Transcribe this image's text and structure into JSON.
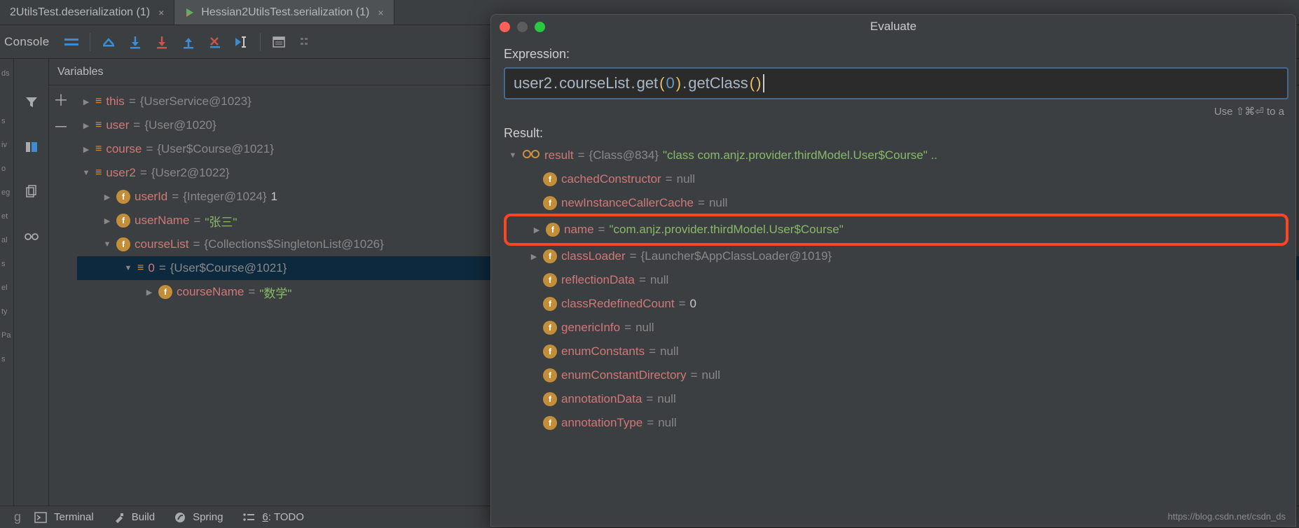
{
  "tabs": [
    {
      "label": "2UtilsTest.deserialization (1)",
      "active": false
    },
    {
      "label": "Hessian2UtilsTest.serialization (1)",
      "active": true
    }
  ],
  "toolbar": {
    "console_label": "Console"
  },
  "leftstrip": [
    "ds",
    "",
    "s",
    "iv",
    "o",
    "eg",
    "et",
    "al",
    "s",
    "el",
    "ty",
    "Pa",
    "s"
  ],
  "vars_header": "Variables",
  "tree": [
    {
      "indent": 0,
      "arrow": "right",
      "icon": "bars",
      "name": "this",
      "eq": " = ",
      "val": "{UserService@1023}",
      "valclass": "val-gray"
    },
    {
      "indent": 0,
      "arrow": "right",
      "icon": "bars",
      "name": "user",
      "eq": " = ",
      "val": "{User@1020}",
      "valclass": "val-gray"
    },
    {
      "indent": 0,
      "arrow": "right",
      "icon": "bars",
      "name": "course",
      "eq": " = ",
      "val": "{User$Course@1021}",
      "valclass": "val-gray"
    },
    {
      "indent": 0,
      "arrow": "down",
      "icon": "bars",
      "name": "user2",
      "eq": " = ",
      "val": "{User2@1022}",
      "valclass": "val-gray"
    },
    {
      "indent": 1,
      "arrow": "right",
      "icon": "field",
      "name": "userId",
      "eq": " = ",
      "val": "{Integer@1024} ",
      "valclass": "val-gray",
      "suffix": "1",
      "sfx": "val-num"
    },
    {
      "indent": 1,
      "arrow": "right",
      "icon": "field",
      "name": "userName",
      "eq": " = ",
      "val": "\"张三\"",
      "valclass": "val-greenstr"
    },
    {
      "indent": 1,
      "arrow": "down",
      "icon": "field",
      "name": "courseList",
      "eq": " = ",
      "val": "{Collections$SingletonList@1026}",
      "valclass": "val-gray"
    },
    {
      "indent": 2,
      "arrow": "down",
      "icon": "bars",
      "name": "0",
      "eq": " = ",
      "val": "{User$Course@1021}",
      "valclass": "val-gray",
      "selected": true
    },
    {
      "indent": 3,
      "arrow": "right",
      "icon": "field",
      "name": "courseName",
      "eq": " = ",
      "val": "\"数学\"",
      "valclass": "val-greenstr"
    }
  ],
  "bottom": {
    "terminal": "Terminal",
    "build": "Build",
    "spring": "Spring",
    "todo": "6: TODO"
  },
  "evaluate": {
    "title": "Evaluate",
    "expression_label": "Expression:",
    "expr_tokens": [
      {
        "t": "user2",
        "c": "id"
      },
      {
        "t": ".",
        "c": "dot-tok"
      },
      {
        "t": "courseList",
        "c": "id"
      },
      {
        "t": ".",
        "c": "dot-tok"
      },
      {
        "t": "get",
        "c": "method"
      },
      {
        "t": "(",
        "c": "paren"
      },
      {
        "t": "0",
        "c": "num"
      },
      {
        "t": ")",
        "c": "paren"
      },
      {
        "t": ".",
        "c": "dot-tok"
      },
      {
        "t": "getClass",
        "c": "method"
      },
      {
        "t": "(",
        "c": "paren"
      },
      {
        "t": ")",
        "c": "paren"
      }
    ],
    "hint": "Use ⇧⌘⏎ to a",
    "result_label": "Result:",
    "url": "https://blog.csdn.net/csdn_ds",
    "result_rows": [
      {
        "indent": 0,
        "arrow": "down",
        "icon": "glasses",
        "name": "result",
        "eq": " = ",
        "val": "{Class@834} ",
        "valclass": "val-gray",
        "suffix": "\"class com.anjz.provider.thirdModel.User$Course\" ..",
        "sfx": "val-greenstr"
      },
      {
        "indent": 1,
        "arrow": "",
        "icon": "field",
        "name": "cachedConstructor",
        "eq": " = ",
        "val": "null",
        "valclass": "val-gray"
      },
      {
        "indent": 1,
        "arrow": "",
        "icon": "field",
        "name": "newInstanceCallerCache",
        "eq": " = ",
        "val": "null",
        "valclass": "val-gray"
      },
      {
        "indent": 1,
        "arrow": "right",
        "icon": "field",
        "name": "name",
        "eq": " = ",
        "val": "\"com.anjz.provider.thirdModel.User$Course\"",
        "valclass": "val-greenstr",
        "highlight": true
      },
      {
        "indent": 1,
        "arrow": "right",
        "icon": "field",
        "name": "classLoader",
        "eq": " = ",
        "val": "{Launcher$AppClassLoader@1019}",
        "valclass": "val-gray"
      },
      {
        "indent": 1,
        "arrow": "",
        "icon": "field",
        "name": "reflectionData",
        "eq": " = ",
        "val": "null",
        "valclass": "val-gray"
      },
      {
        "indent": 1,
        "arrow": "",
        "icon": "field",
        "name": "classRedefinedCount",
        "eq": " = ",
        "val": "0",
        "valclass": "val-num"
      },
      {
        "indent": 1,
        "arrow": "",
        "icon": "field",
        "name": "genericInfo",
        "eq": " = ",
        "val": "null",
        "valclass": "val-gray"
      },
      {
        "indent": 1,
        "arrow": "",
        "icon": "field",
        "name": "enumConstants",
        "eq": " = ",
        "val": "null",
        "valclass": "val-gray"
      },
      {
        "indent": 1,
        "arrow": "",
        "icon": "field",
        "name": "enumConstantDirectory",
        "eq": " = ",
        "val": "null",
        "valclass": "val-gray"
      },
      {
        "indent": 1,
        "arrow": "",
        "icon": "field",
        "name": "annotationData",
        "eq": " = ",
        "val": "null",
        "valclass": "val-gray"
      },
      {
        "indent": 1,
        "arrow": "",
        "icon": "field",
        "name": "annotationType",
        "eq": " = ",
        "val": "null",
        "valclass": "val-gray"
      }
    ]
  }
}
